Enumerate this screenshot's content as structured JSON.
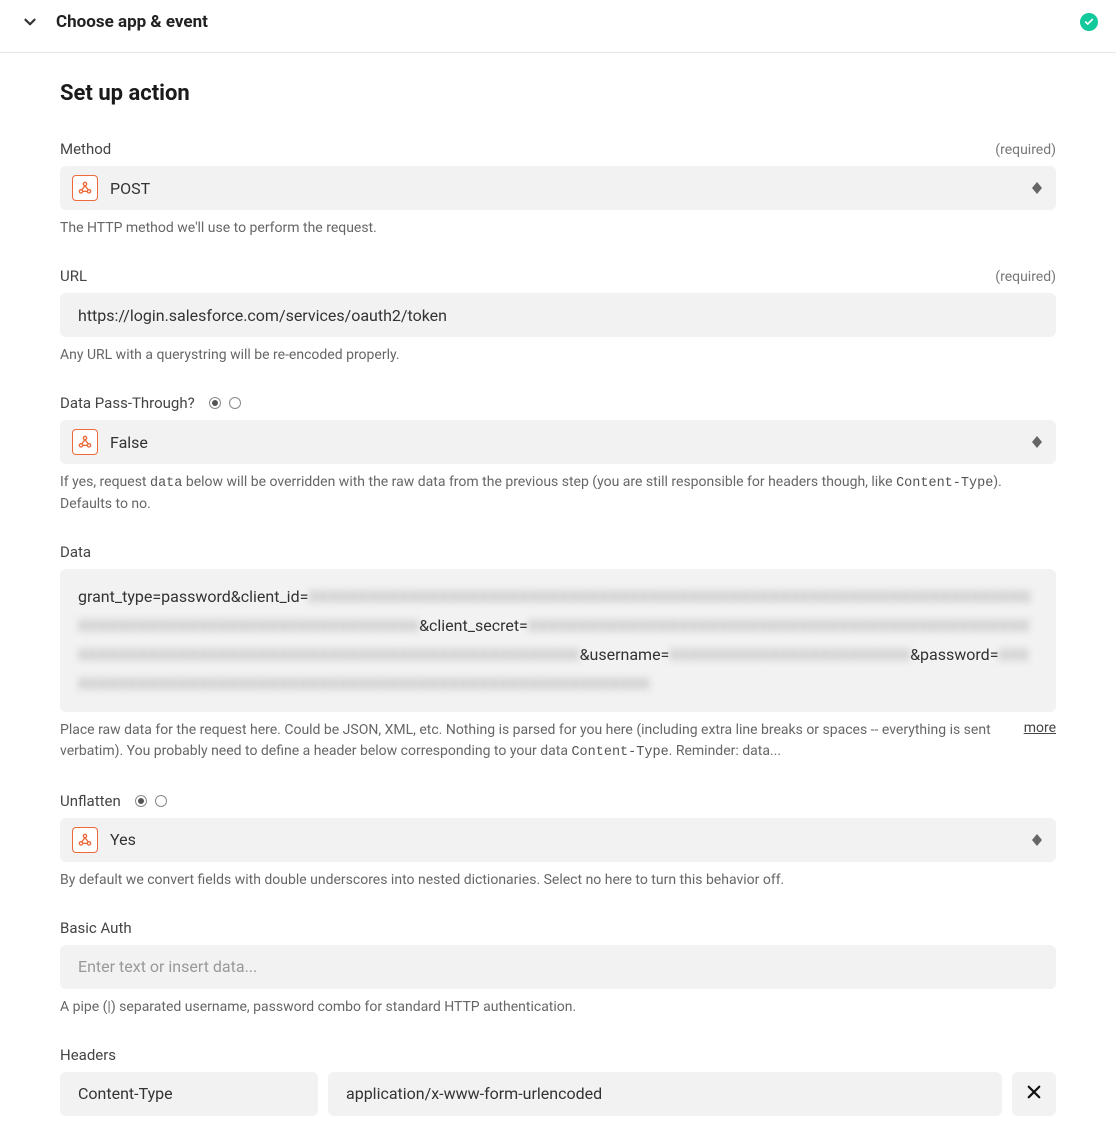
{
  "header": {
    "title": "Choose app & event"
  },
  "section": {
    "title": "Set up action"
  },
  "fields": {
    "method": {
      "label": "Method",
      "required_text": "(required)",
      "value": "POST",
      "help": "The HTTP method we'll use to perform the request."
    },
    "url": {
      "label": "URL",
      "required_text": "(required)",
      "value": "https://login.salesforce.com/services/oauth2/token",
      "help": "Any URL with a querystring will be re-encoded properly."
    },
    "pass_through": {
      "label": "Data Pass-Through?",
      "value": "False",
      "help_before": "If yes, request ",
      "help_code1": "data",
      "help_mid": " below will be overridden with the raw data from the previous step (you are still responsible for headers though, like ",
      "help_code2": "Content-Type",
      "help_after": "). Defaults to no."
    },
    "data": {
      "label": "Data",
      "seg1": "grant_type=password&client_id=",
      "red1": "XXXXXXXXXXXXXXXXXXXXXXXXXXXXXXXXXXXXXXXXXXXXXXXXXXXXXXXXXXXXXXXXXXXXXXXXXXXXXXXXXXXXXXXXXXXXXXXXXXXXXXXXXX",
      "seg2": "&client_secret=",
      "red2": "XXXXXXXXXXXXXXXXXXXXXXXXXXXXXXXXXXXXXXXXXXXXXXXXXXXXXXXXXXXXXXXXXXXXXXXXXXXXXXXXXXXXXXXXXXXXXXXXXXXX",
      "seg3": "&username=",
      "red3": "XXXXXXXXXXXXXXXXXXXXXXXX",
      "seg4": "&password=",
      "red4": "XXXXXXXXXXXXXXXXXXXXXXXXXXXXXXXXXXXXXXXXXXXXXXXXXXXXXXXXXXXX",
      "help_pre": "Place raw data for the request here. Could be JSON, XML, etc. Nothing is parsed for you here (including extra line breaks or spaces -- everything is sent verbatim). You probably need to define a header below corresponding to your data ",
      "help_code": "Content-Type",
      "help_post": ". Reminder: data...",
      "more_label": "more"
    },
    "unflatten": {
      "label": "Unflatten",
      "value": "Yes",
      "help": "By default we convert fields with double underscores into nested dictionaries. Select no here to turn this behavior off."
    },
    "basic_auth": {
      "label": "Basic Auth",
      "placeholder": "Enter text or insert data...",
      "help": "A pipe (|) separated username, password combo for standard HTTP authentication."
    },
    "headers": {
      "label": "Headers",
      "rows": [
        {
          "key": "Content-Type",
          "value": "application/x-www-form-urlencoded"
        }
      ]
    }
  }
}
